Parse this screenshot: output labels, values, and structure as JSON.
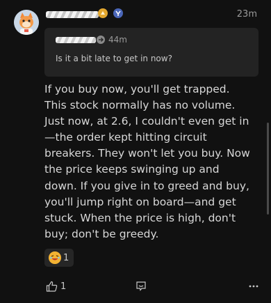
{
  "post": {
    "time": "23m",
    "quoted": {
      "time": "44m",
      "text": "Is it a bit late to get in now?"
    },
    "body": "If you buy now, you'll get trapped. This stock normally has no volume. Just now, at 2.6, I couldn't even get in—the order kept hitting circuit breakers. They won't let you buy. Now the price keeps swinging up and down. If you give in to greed and buy, you'll jump right on board—and get stuck. When the price is high, don't buy; don't be greedy.",
    "reaction": {
      "icon": "laughing-emoji-icon",
      "count": "1"
    },
    "like_count": "1",
    "badges": [
      "gold-badge-icon",
      "blue-badge-icon"
    ],
    "icons": [
      "thumbs-up-icon",
      "comment-icon",
      "more-icon",
      "arrow-right-icon"
    ]
  }
}
